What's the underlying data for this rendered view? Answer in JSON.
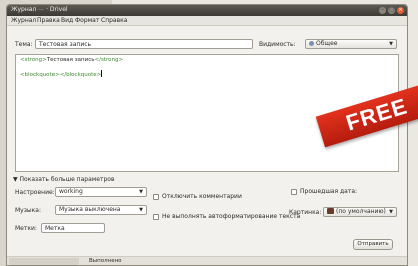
{
  "window": {
    "title_app": "Журнал",
    "title_blurred": " — ",
    "title_site": " · Drivel",
    "controls": [
      "–",
      "□",
      "×"
    ]
  },
  "menu": [
    "Журнал",
    "Правка",
    "Вид",
    "Формат",
    "Справка"
  ],
  "subject": {
    "label": "Тема:",
    "value": "Тестовая запись"
  },
  "visibility": {
    "label": "Видимость:",
    "value": "Общее",
    "icon": "globe-icon"
  },
  "editor": {
    "line1_open_tag": "<strong>",
    "line1_text": "Тестовая запись",
    "line1_close_tag": "</strong>",
    "line2_open_tag": "<blockquote>",
    "line2_close_tag": "</blockquote>"
  },
  "more_params": {
    "label": "Показать больше параметров",
    "arrow": "▼"
  },
  "mood": {
    "label": "Настроение:",
    "value": "working"
  },
  "music": {
    "label": "Музыка:",
    "value": "Музыка выключена"
  },
  "tags": {
    "label": "Метки:",
    "value": "Метка"
  },
  "options": {
    "disable_comments": "Отключить комментарии",
    "no_autoformat": "Не выполнять автоформатирование текста",
    "past_date": "Прошедшая дата:"
  },
  "picture": {
    "label": "Картинка:",
    "value": "(по умолчанию)"
  },
  "send_button": "Отправить",
  "status": {
    "text": "Выполнено"
  },
  "overlay": {
    "badge": "FREE"
  },
  "colors": {
    "badge_red": "#d02a16",
    "tag_green": "#3d8a2e",
    "titlebar": "#46433e"
  }
}
